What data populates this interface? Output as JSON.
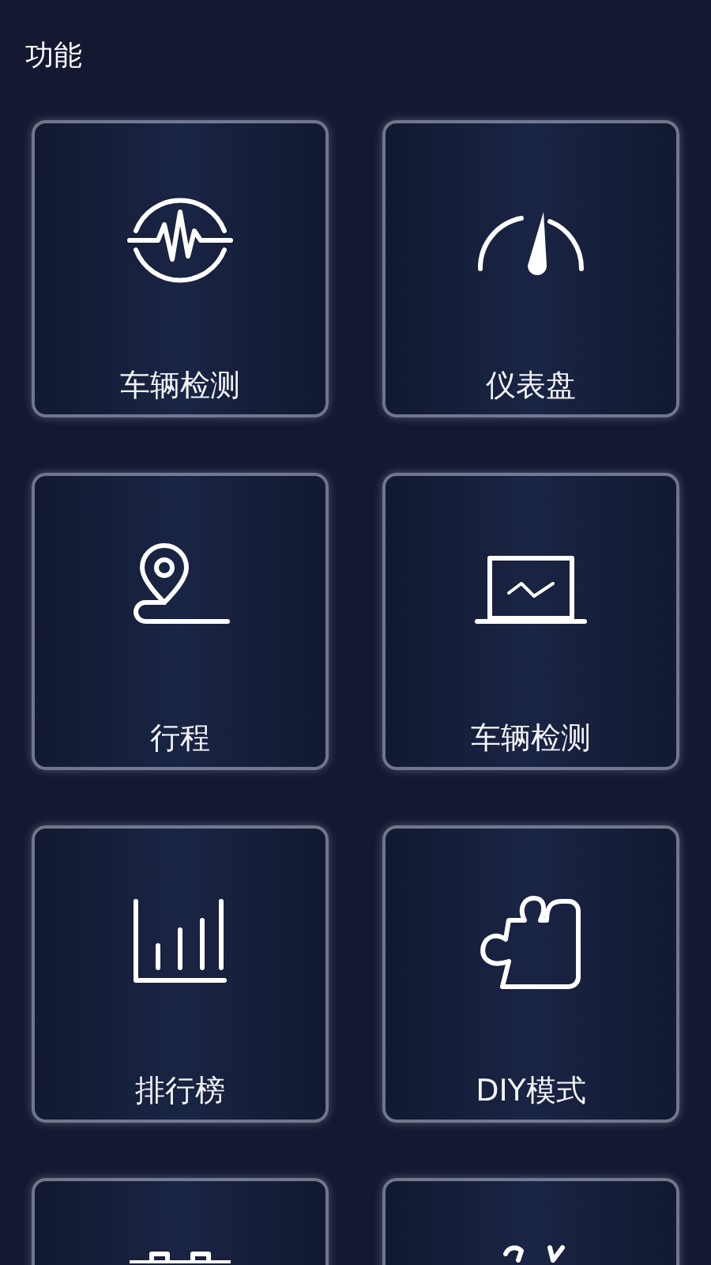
{
  "header": {
    "title": "功能"
  },
  "tiles": [
    {
      "label": "车辆检测",
      "kind": "full"
    },
    {
      "label": "仪表盘",
      "kind": "full"
    },
    {
      "label": "行程",
      "kind": "full"
    },
    {
      "label": "车辆检测",
      "kind": "full"
    },
    {
      "label": "排行榜",
      "kind": "full"
    },
    {
      "label": "DIY模式",
      "kind": "full"
    },
    {
      "kind": "clipped"
    },
    {
      "kind": "clipped"
    }
  ]
}
